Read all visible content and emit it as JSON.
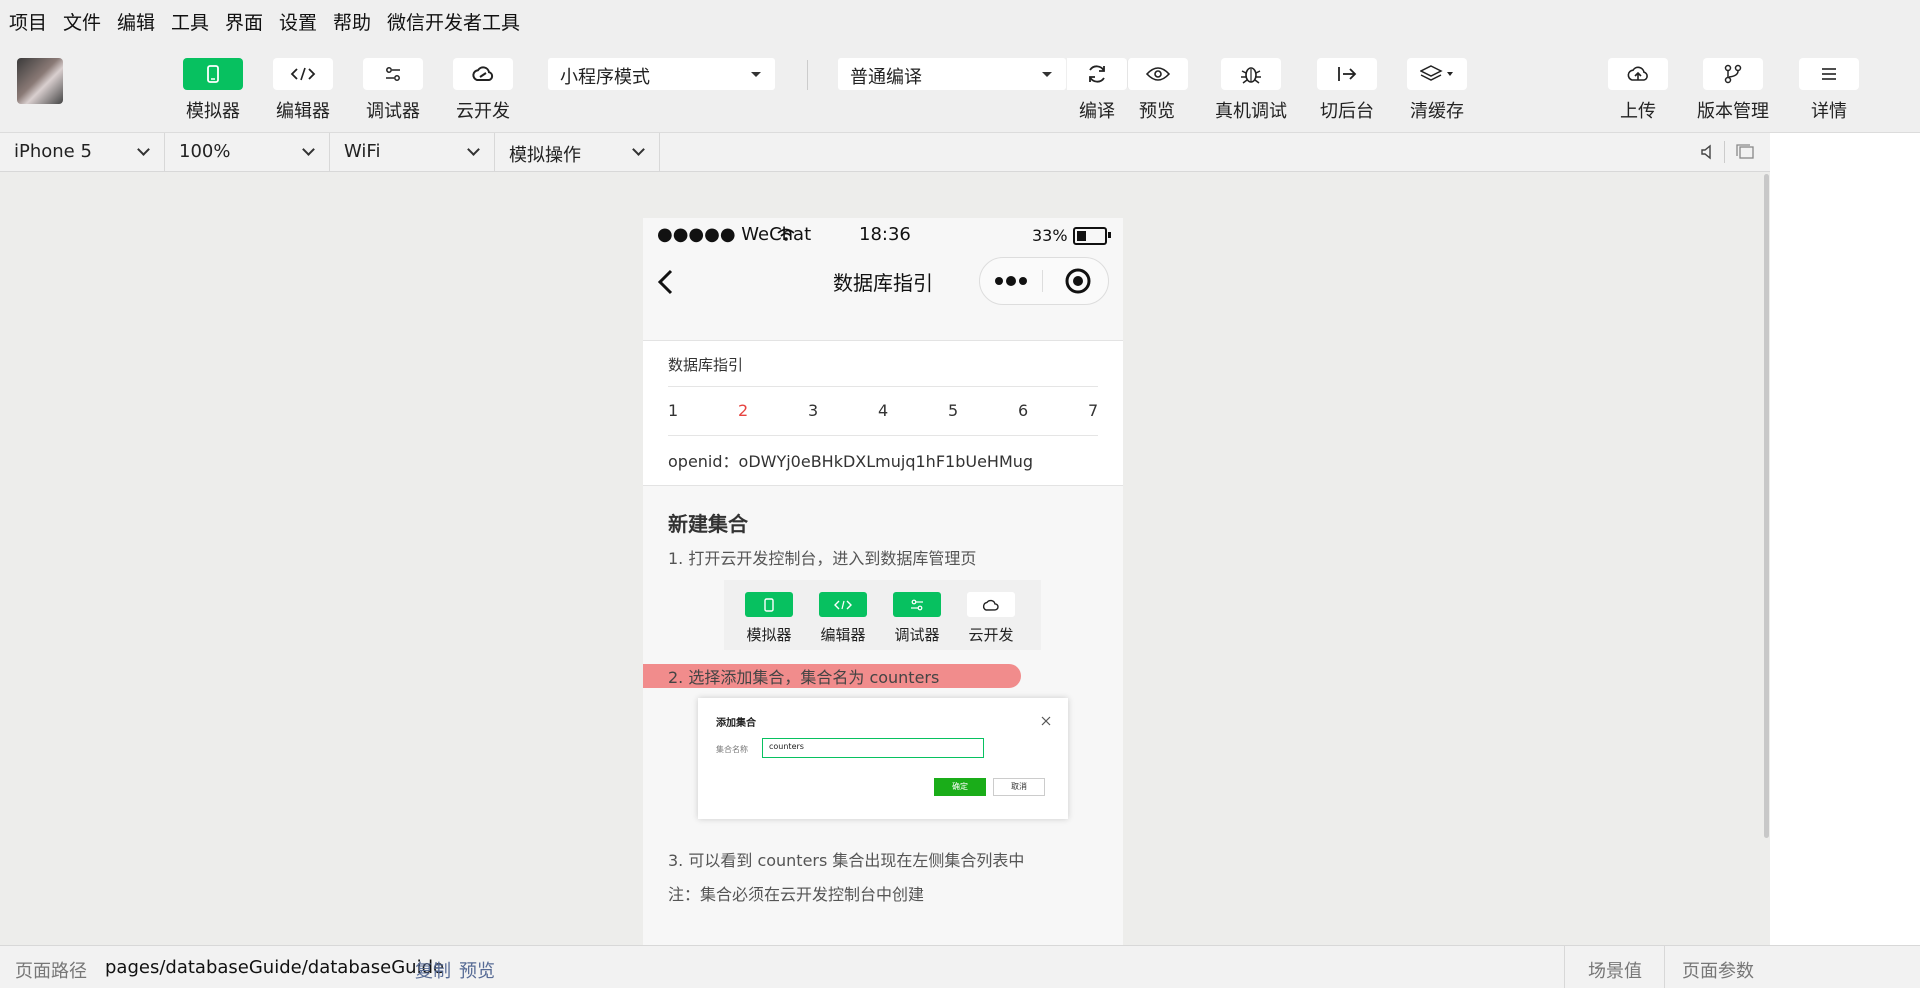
{
  "menu": [
    "项目",
    "文件",
    "编辑",
    "工具",
    "界面",
    "设置",
    "帮助",
    "微信开发者工具"
  ],
  "toolbar": {
    "left_buttons": [
      {
        "label": "模拟器",
        "icon": "phone-icon",
        "active": true
      },
      {
        "label": "编辑器",
        "icon": "code-icon",
        "active": true
      },
      {
        "label": "调试器",
        "icon": "debugger-icon",
        "active": false
      },
      {
        "label": "云开发",
        "icon": "cloud-icon",
        "active": false
      }
    ],
    "mode_select": "小程序模式",
    "compile_select": "普通编译",
    "right_buttons": [
      {
        "label": "编译",
        "icon": "refresh-icon"
      },
      {
        "label": "预览",
        "icon": "eye-icon"
      },
      {
        "label": "真机调试",
        "icon": "bug-icon"
      },
      {
        "label": "切后台",
        "icon": "switch-background-icon"
      },
      {
        "label": "清缓存",
        "icon": "layers-icon"
      },
      {
        "label": "上传",
        "icon": "cloud-upload-icon"
      },
      {
        "label": "版本管理",
        "icon": "branch-icon"
      },
      {
        "label": "详情",
        "icon": "menu-icon"
      }
    ]
  },
  "device_bar": {
    "device": "iPhone 5",
    "zoom": "100%",
    "network": "WiFi",
    "operation": "模拟操作"
  },
  "phone": {
    "status": {
      "carrier": "●●●●● WeChat",
      "time": "18:36",
      "battery": "33%"
    },
    "nav_title": "数据库指引",
    "card_title": "数据库指引",
    "steps": [
      "1",
      "2",
      "3",
      "4",
      "5",
      "6",
      "7"
    ],
    "active_step": "2",
    "openid": "openid：oDWYj0eBHkDXLmujq1hF1bUeHMug",
    "section_title": "新建集合",
    "p1": "1. 打开云开发控制台，进入到数据库管理页",
    "mini_buttons": [
      "模拟器",
      "编辑器",
      "调试器",
      "云开发"
    ],
    "p2": "2. 选择添加集合，集合名为 counters",
    "dialog": {
      "title": "添加集合",
      "field_label": "集合名称",
      "field_value": "counters",
      "ok": "确定",
      "cancel": "取消"
    },
    "p3": "3. 可以看到 counters 集合出现在左侧集合列表中",
    "note": "注：集合必须在云开发控制台中创建"
  },
  "statusbar": {
    "path_label": "页面路径",
    "path": "pages/databaseGuide/databaseGuide",
    "copy": "复制",
    "preview": "预览",
    "scene": "场景值",
    "params": "页面参数"
  },
  "colors": {
    "accent": "#07c160",
    "link": "#576b95",
    "active_step": "#e64340",
    "highlight": "#f08080"
  }
}
